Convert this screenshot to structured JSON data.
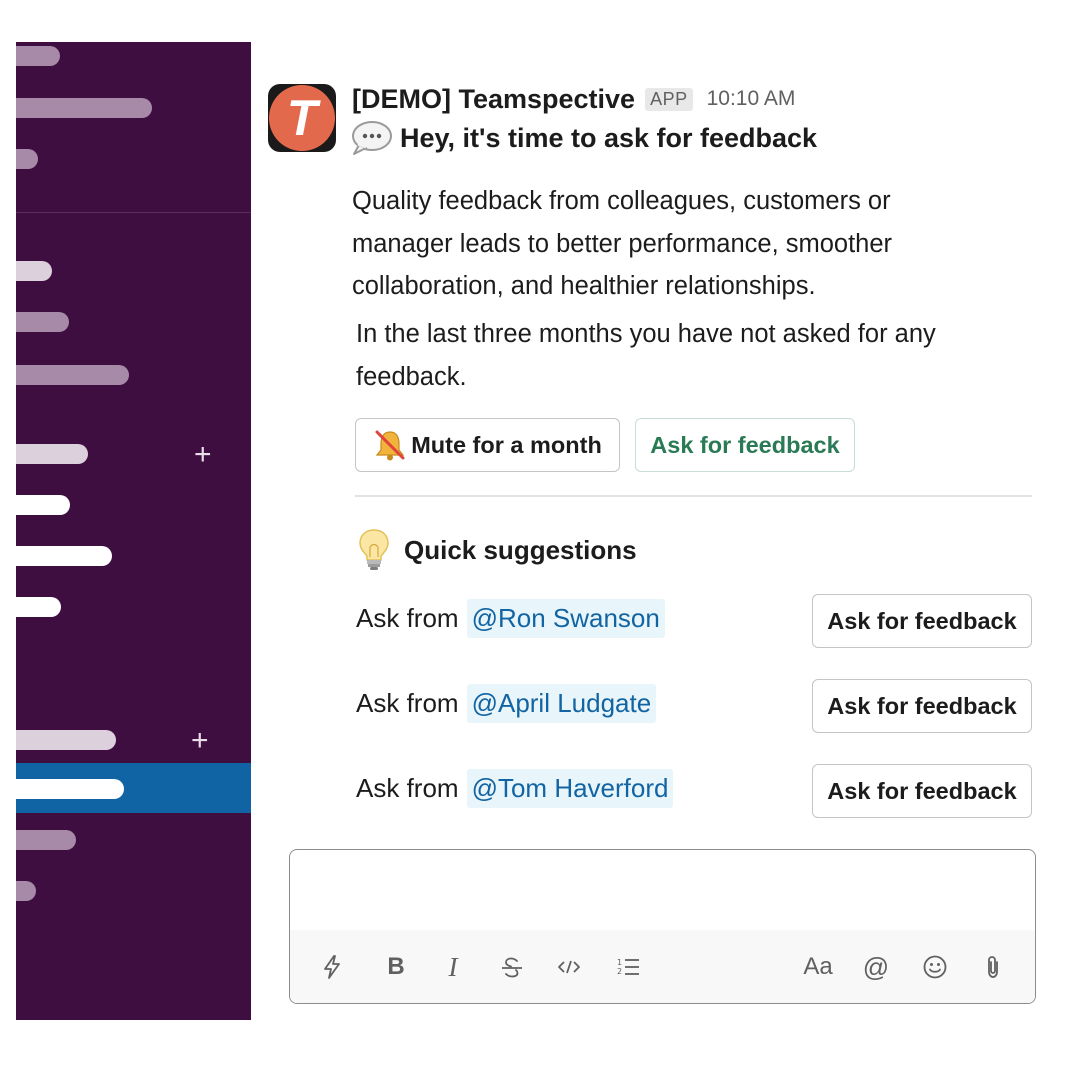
{
  "message": {
    "avatar_letter": "T",
    "sender": "[DEMO] Teamspective",
    "badge": "APP",
    "time": "10:10 AM",
    "headline": "Hey, it's time to ask for feedback",
    "paragraph1": "Quality feedback from colleagues, customers or manager leads to better performance, smoother collaboration, and healthier relationships.",
    "paragraph2": "In the last three months you have not asked for any feedback.",
    "buttons": {
      "mute": "Mute for a month",
      "ask": "Ask for feedback"
    }
  },
  "quick_suggestions": {
    "title": "Quick suggestions",
    "rows": [
      {
        "prefix": "Ask from",
        "mention": "@Ron Swanson",
        "button": "Ask for feedback"
      },
      {
        "prefix": "Ask from",
        "mention": "@April Ludgate",
        "button": "Ask for feedback"
      },
      {
        "prefix": "Ask from",
        "mention": "@Tom Haverford",
        "button": "Ask for feedback"
      }
    ]
  },
  "composer": {
    "placeholder": "",
    "tools": {
      "bold": "B",
      "italic": "I",
      "text_size": "Aa",
      "mention": "@"
    }
  },
  "icons": {
    "sidebar_add": "plus-icon",
    "headline": "speech-bubble-icon",
    "mute": "muted-bell-icon",
    "suggestions": "light-bulb-icon"
  },
  "colors": {
    "sidebar": "#3f0e40",
    "sidebar_active": "#1164a3",
    "avatar": "#e3694c",
    "primary_button_text": "#2a7a55",
    "mention_text": "#1264a3",
    "mention_bg": "#e8f5fa"
  }
}
